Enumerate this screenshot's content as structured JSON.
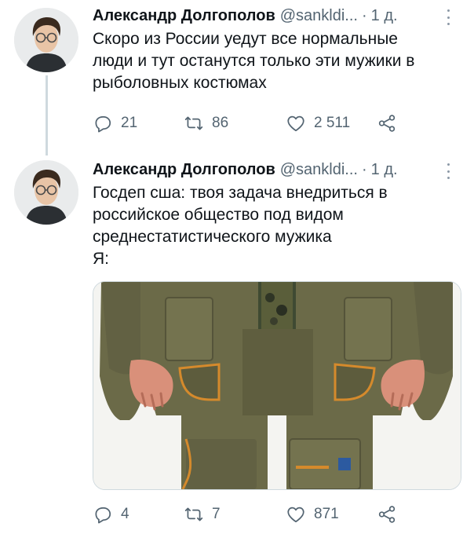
{
  "tweets": [
    {
      "author_name": "Александр Долгополов",
      "handle": "@sankldi...",
      "separator": "·",
      "time": "1 д.",
      "text_lines": [
        "Скоро из России уедут все нормальные",
        "люди и тут останутся только эти мужики в",
        "рыболовных костюмах"
      ],
      "replies": "21",
      "retweets": "86",
      "likes": "2 511"
    },
    {
      "author_name": "Александр Долгополов",
      "handle": "@sankldi...",
      "separator": "·",
      "time": "1 д.",
      "text_lines": [
        "Госдеп сша: твоя задача внедриться в",
        "российское общество под видом",
        "среднестатистического мужика",
        "Я:"
      ],
      "media_description": "photo of a man in an olive fishing suit",
      "replies": "4",
      "retweets": "7",
      "likes": "871"
    }
  ],
  "icons": {
    "reply": "reply-icon",
    "retweet": "retweet-icon",
    "like": "heart-icon",
    "share": "share-icon",
    "more": "more-options-icon"
  },
  "colors": {
    "text_primary": "#0f1419",
    "text_secondary": "#536471",
    "thread_line": "#cfd9de",
    "suit_olive": "#6b6a48",
    "suit_accent": "#d58a2c"
  }
}
